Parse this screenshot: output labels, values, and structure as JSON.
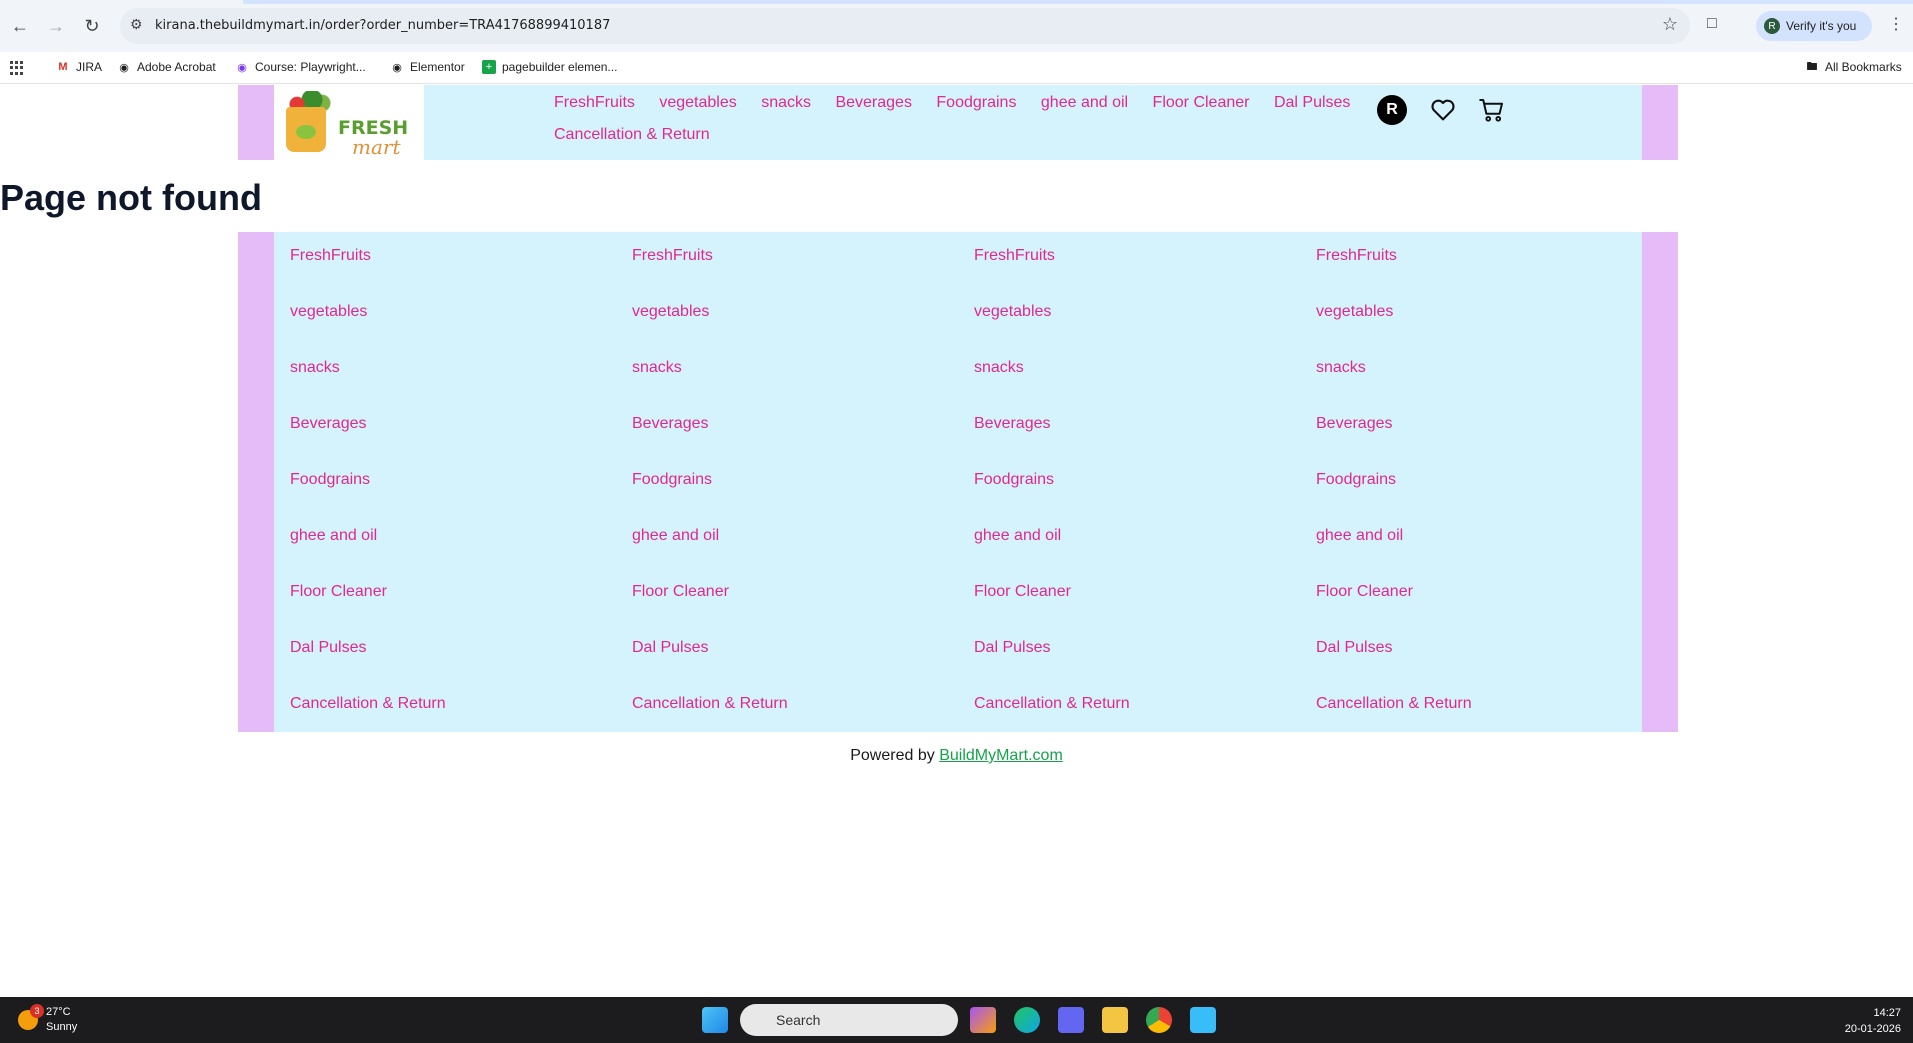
{
  "browser": {
    "url": "kirana.thebuildmymart.in/order?order_number=TRA41768899410187",
    "verify_label": "Verify it's you",
    "profile_initial": "R",
    "bookmarks": [
      "JIRA",
      "Adobe Acrobat",
      "Course: Playwright...",
      "Elementor",
      "pagebuilder elemen..."
    ],
    "all_bookmarks": "All Bookmarks"
  },
  "header": {
    "logo_text_1": "FRESH",
    "logo_text_2": "mart",
    "nav": [
      "FreshFruits",
      "vegetables",
      "snacks",
      "Beverages",
      "Foodgrains",
      "ghee and oil",
      "Floor Cleaner",
      "Dal Pulses",
      "Cancellation & Return"
    ],
    "user_initial": "R"
  },
  "main": {
    "title": "Page not found",
    "columns": [
      [
        "FreshFruits",
        "vegetables",
        "snacks",
        "Beverages",
        "Foodgrains",
        "ghee and oil",
        "Floor Cleaner",
        "Dal Pulses",
        "Cancellation & Return"
      ],
      [
        "FreshFruits",
        "vegetables",
        "snacks",
        "Beverages",
        "Foodgrains",
        "ghee and oil",
        "Floor Cleaner",
        "Dal Pulses",
        "Cancellation & Return"
      ],
      [
        "FreshFruits",
        "vegetables",
        "snacks",
        "Beverages",
        "Foodgrains",
        "ghee and oil",
        "Floor Cleaner",
        "Dal Pulses",
        "Cancellation & Return"
      ],
      [
        "FreshFruits",
        "vegetables",
        "snacks",
        "Beverages",
        "Foodgrains",
        "ghee and oil",
        "Floor Cleaner",
        "Dal Pulses",
        "Cancellation & Return"
      ]
    ]
  },
  "footer": {
    "prefix": "Powered by",
    "link": "BuildMyMart.com"
  },
  "taskbar": {
    "temp": "27°C",
    "weather": "Sunny",
    "badge": "3",
    "search_placeholder": "Search",
    "time": "14:27",
    "date": "20-01-2026"
  },
  "colors": {
    "link_pink": "#e0288f",
    "panel_blue": "#d5f3fd",
    "side_purple": "#e6bcf8",
    "footer_green": "#16a34a"
  }
}
